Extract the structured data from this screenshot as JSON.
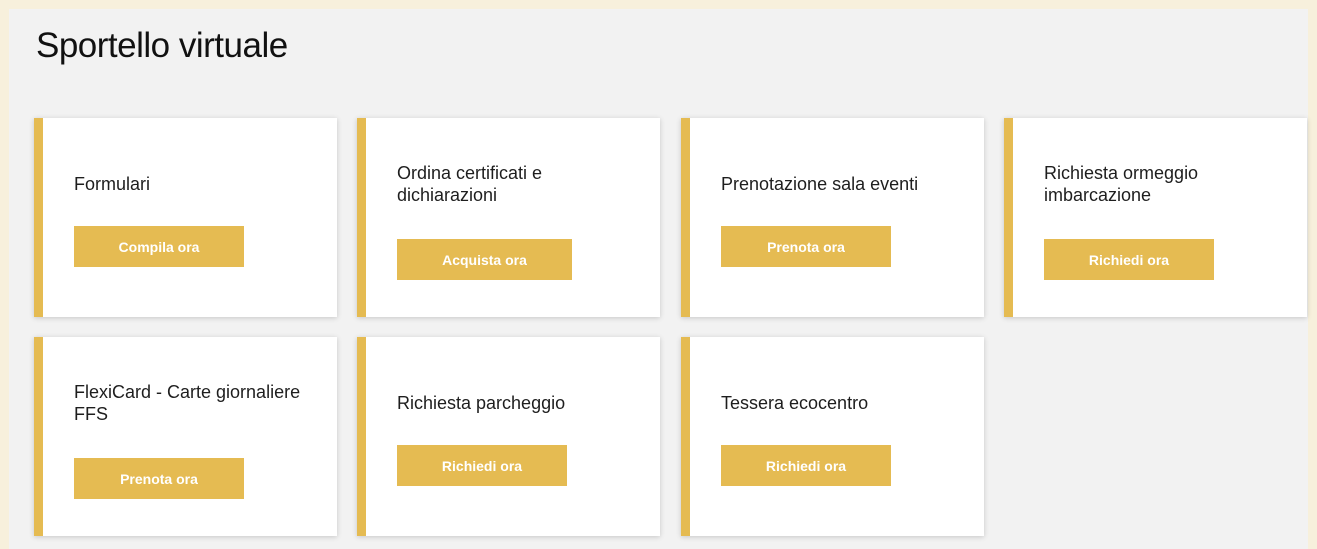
{
  "page": {
    "title": "Sportello virtuale"
  },
  "colors": {
    "accent": "#e5bb52",
    "card_background": "#ffffff",
    "page_background": "#f2f2f2",
    "frame_background": "#f7f0dc"
  },
  "cards": [
    {
      "title": "Formulari",
      "button": "Compila ora"
    },
    {
      "title": "Ordina certificati e dichiarazioni",
      "button": "Acquista ora"
    },
    {
      "title": "Prenotazione sala eventi",
      "button": "Prenota ora"
    },
    {
      "title": "Richiesta ormeggio imbarcazione",
      "button": "Richiedi ora"
    },
    {
      "title": "FlexiCard - Carte giornaliere FFS",
      "button": "Prenota ora"
    },
    {
      "title": "Richiesta parcheggio",
      "button": "Richiedi ora"
    },
    {
      "title": "Tessera ecocentro",
      "button": "Richiedi ora"
    }
  ]
}
